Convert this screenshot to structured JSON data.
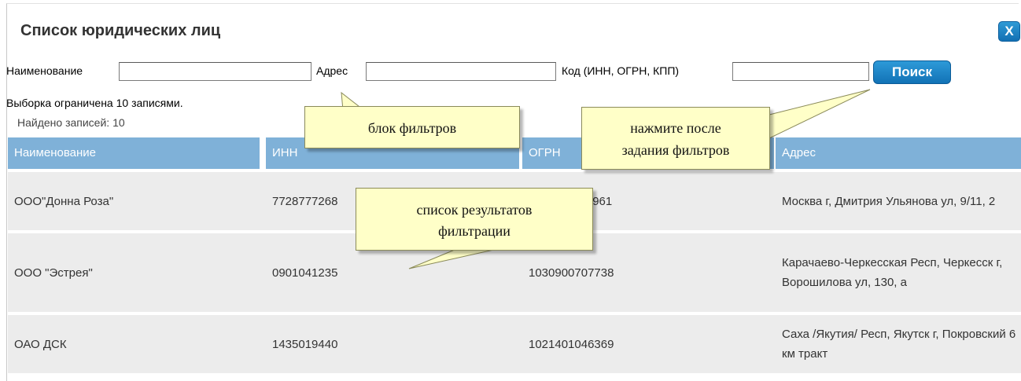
{
  "dialog": {
    "title": "Список юридических лиц",
    "close_label": "X"
  },
  "filters": {
    "name_label": "Наименование",
    "name_value": "",
    "address_label": "Адрес",
    "address_value": "",
    "code_label": "Код (ИНН, ОГРН, КПП)",
    "code_value": "",
    "search_label": "Поиск"
  },
  "status": {
    "limit_text": "Выборка ограничена 10 записями.",
    "found_text": "Найдено записей: 10"
  },
  "table": {
    "headers": [
      "Наименование",
      "ИНН",
      "ОГРН",
      "Адрес"
    ],
    "rows": [
      {
        "name": "ООО\"Донна Роза\"",
        "inn": "7728777268",
        "ogrn": "1117746535961",
        "address": "Москва г, Дмитрия Ульянова ул, 9/11, 2"
      },
      {
        "name": "ООО \"Эстрея\"",
        "inn": "0901041235",
        "ogrn": "1030900707738",
        "address": "Карачаево-Черкесская Респ, Черкесск г, Ворошилова ул, 130, а"
      },
      {
        "name": "ОАО ДСК",
        "inn": "1435019440",
        "ogrn": "1021401046369",
        "address": "Саха /Якутия/ Респ, Якутск г, Покровский 6 км тракт"
      }
    ]
  },
  "callouts": {
    "filters_block": "блок фильтров",
    "press_after_line1": "нажмите после",
    "press_after_line2": "задания фильтров",
    "results_line1": "список результатов",
    "results_line2": "фильтрации"
  },
  "colors": {
    "accent": "#1a7fc4",
    "header_bg": "#7fb1d8",
    "row_bg": "#ececec",
    "callout_bg": "#ffffc8"
  }
}
